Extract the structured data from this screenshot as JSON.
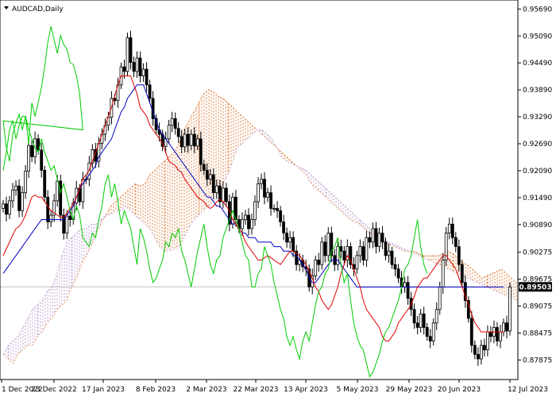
{
  "chart_data": {
    "type": "candlestick",
    "title": "AUDCAD,Daily",
    "timeframe": "Daily",
    "symbol": "AUDCAD",
    "current_price": 0.89503,
    "current_price_label": "0.89503",
    "ylim": [
      0.8744,
      0.9589
    ],
    "y_ticks": [
      "0.95690",
      "0.95090",
      "0.94490",
      "0.93890",
      "0.93290",
      "0.92690",
      "0.92090",
      "0.91490",
      "0.90890",
      "0.90275",
      "0.89675",
      "0.89075",
      "0.88475",
      "0.87875"
    ],
    "x_ticks": [
      "1 Dec 2022",
      "23 Dec 2022",
      "17 Jan 2023",
      "8 Feb 2023",
      "2 Mar 2023",
      "22 Mar 2023",
      "13 Apr 2023",
      "5 May 2023",
      "29 May 2023",
      "20 Jun 2023",
      "12 Jul 2023"
    ],
    "grid": false,
    "colors": {
      "candle": "#000000",
      "tenkan": "#dd0000",
      "kijun": "#0000bb",
      "chikou": "#00cc00",
      "cloud_bullish": "#e08040",
      "cloud_bearish": "#c0a0d0",
      "price_line": "#c0c0c0",
      "price_label_bg": "#000000"
    },
    "series": [
      {
        "name": "close",
        "values": [
          0.9135,
          0.9112,
          0.9142,
          0.9166,
          0.9175,
          0.912,
          0.916,
          0.9208,
          0.9265,
          0.924,
          0.928,
          0.9255,
          0.921,
          0.915,
          0.9095,
          0.911,
          0.9142,
          0.9186,
          0.911,
          0.907,
          0.9108,
          0.91,
          0.9137,
          0.917,
          0.914,
          0.919,
          0.919,
          0.9226,
          0.9256,
          0.923,
          0.927,
          0.929,
          0.931,
          0.9328,
          0.937,
          0.9365,
          0.94,
          0.944,
          0.943,
          0.9505,
          0.945,
          0.943,
          0.946,
          0.942,
          0.9435,
          0.94,
          0.937,
          0.9325,
          0.93,
          0.929,
          0.9263,
          0.928,
          0.931,
          0.9325,
          0.9303,
          0.9285,
          0.9262,
          0.929,
          0.9265,
          0.929,
          0.9264,
          0.928,
          0.9223,
          0.921,
          0.919,
          0.92,
          0.916,
          0.9175,
          0.914,
          0.917,
          0.914,
          0.909,
          0.915,
          0.91,
          0.908,
          0.91,
          0.911,
          0.908,
          0.91,
          0.914,
          0.918,
          0.919,
          0.915,
          0.916,
          0.9125,
          0.9125,
          0.912,
          0.9095,
          0.907,
          0.905,
          0.906,
          0.903,
          0.9,
          0.901,
          0.8995,
          0.899,
          0.895,
          0.8975,
          0.901,
          0.9,
          0.905,
          0.902,
          0.907,
          0.902,
          0.9,
          0.904,
          0.903,
          0.901,
          0.904,
          0.9,
          0.899,
          0.902,
          0.904,
          0.901,
          0.906,
          0.905,
          0.908,
          0.904,
          0.907,
          0.905,
          0.902,
          0.903,
          0.9,
          0.899,
          0.897,
          0.895,
          0.896,
          0.8925,
          0.89,
          0.887,
          0.886,
          0.889,
          0.886,
          0.884,
          0.883,
          0.887,
          0.89,
          0.895,
          0.901,
          0.907,
          0.909,
          0.906,
          0.904,
          0.9,
          0.896,
          0.892,
          0.888,
          0.882,
          0.88,
          0.879,
          0.882,
          0.881,
          0.885,
          0.884,
          0.886,
          0.883,
          0.885,
          0.887,
          0.8852,
          0.895
        ]
      },
      {
        "name": "tenkan",
        "values": [
          0.902,
          0.9035,
          0.905,
          0.9065,
          0.908,
          0.9085,
          0.9095,
          0.911,
          0.913,
          0.915,
          0.9155,
          0.915,
          0.915,
          0.914,
          0.913,
          0.912,
          0.9115,
          0.911,
          0.9105,
          0.9105,
          0.9115,
          0.9125,
          0.9135,
          0.915,
          0.917,
          0.919,
          0.92,
          0.921,
          0.923,
          0.925,
          0.927,
          0.929,
          0.931,
          0.933,
          0.935,
          0.9375,
          0.94,
          0.942,
          0.942,
          0.942,
          0.942,
          0.94,
          0.938,
          0.935,
          0.934,
          0.933,
          0.931,
          0.93,
          0.929,
          0.928,
          0.927,
          0.925,
          0.923,
          0.9225,
          0.922,
          0.921,
          0.9205,
          0.919,
          0.918,
          0.917,
          0.916,
          0.915,
          0.9145,
          0.914,
          0.913,
          0.9125,
          0.913,
          0.914,
          0.9145,
          0.914,
          0.913,
          0.912,
          0.91,
          0.909,
          0.908,
          0.907,
          0.905,
          0.904,
          0.903,
          0.902,
          0.901,
          0.901,
          0.9015,
          0.902,
          0.9015,
          0.901,
          0.9005,
          0.9,
          0.901,
          0.902,
          0.903,
          0.903,
          0.9025,
          0.902,
          0.901,
          0.9,
          0.8985,
          0.897,
          0.895,
          0.894,
          0.892,
          0.891,
          0.89,
          0.891,
          0.893,
          0.895,
          0.898,
          0.9,
          0.902,
          0.901,
          0.899,
          0.897,
          0.895,
          0.892,
          0.89,
          0.889,
          0.888,
          0.887,
          0.886,
          0.884,
          0.883,
          0.883,
          0.884,
          0.885,
          0.887,
          0.888,
          0.889,
          0.89,
          0.891,
          0.893,
          0.895,
          0.896,
          0.897,
          0.897,
          0.898,
          0.899,
          0.9,
          0.901,
          0.902,
          0.902,
          0.901,
          0.9,
          0.899,
          0.897,
          0.895,
          0.893,
          0.891,
          0.889,
          0.887,
          0.886,
          0.885,
          0.885,
          0.885,
          0.885,
          0.885,
          0.885,
          0.885,
          0.885
        ]
      },
      {
        "name": "kijun",
        "values": [
          0.898,
          0.899,
          0.9,
          0.901,
          0.902,
          0.903,
          0.904,
          0.905,
          0.906,
          0.907,
          0.908,
          0.909,
          0.91,
          0.91,
          0.91,
          0.91,
          0.91,
          0.91,
          0.91,
          0.91,
          0.911,
          0.912,
          0.913,
          0.915,
          0.917,
          0.918,
          0.919,
          0.92,
          0.921,
          0.922,
          0.924,
          0.925,
          0.926,
          0.927,
          0.928,
          0.93,
          0.932,
          0.934,
          0.935,
          0.937,
          0.938,
          0.939,
          0.94,
          0.94,
          0.94,
          0.938,
          0.936,
          0.934,
          0.932,
          0.93,
          0.929,
          0.928,
          0.927,
          0.926,
          0.925,
          0.924,
          0.923,
          0.922,
          0.921,
          0.92,
          0.919,
          0.918,
          0.917,
          0.916,
          0.915,
          0.915,
          0.914,
          0.913,
          0.913,
          0.912,
          0.911,
          0.91,
          0.909,
          0.909,
          0.908,
          0.907,
          0.907,
          0.906,
          0.906,
          0.906,
          0.905,
          0.905,
          0.905,
          0.905,
          0.905,
          0.904,
          0.904,
          0.904,
          0.903,
          0.903,
          0.903,
          0.902,
          0.902,
          0.901,
          0.9,
          0.899,
          0.897,
          0.896,
          0.896,
          0.897,
          0.898,
          0.899,
          0.9,
          0.901,
          0.901,
          0.901,
          0.9,
          0.899,
          0.898,
          0.897,
          0.896,
          0.895,
          0.895,
          0.895,
          0.895,
          0.895,
          0.895,
          0.895,
          0.895,
          0.895,
          0.895,
          0.895,
          0.895,
          0.895,
          0.895,
          0.895,
          0.895,
          0.895,
          0.895,
          0.895,
          0.895,
          0.895,
          0.895,
          0.895,
          0.895,
          0.895,
          0.895,
          0.895,
          0.895,
          0.895,
          0.895,
          0.895,
          0.895,
          0.895,
          0.895,
          0.895,
          0.895,
          0.895,
          0.895,
          0.895,
          0.895,
          0.895,
          0.895,
          0.895,
          0.895,
          0.895,
          0.895,
          0.895
        ]
      },
      {
        "name": "chikou",
        "values": [
          0.921,
          0.925,
          0.93,
          0.932,
          0.928,
          0.931,
          0.933,
          0.933,
          0.927,
          0.936,
          0.933,
          0.936,
          0.9395,
          0.944,
          0.9495,
          0.953,
          0.95,
          0.947,
          0.951,
          0.949,
          0.948,
          0.945,
          0.9445,
          0.942,
          0.938,
          0.93,
          0.932,
          0.926,
          0.923,
          0.929,
          0.9315,
          0.9335,
          0.93,
          0.933,
          0.93,
          0.928,
          0.926,
          0.925,
          0.928,
          0.925,
          0.923,
          0.921,
          0.922,
          0.919,
          0.916,
          0.918,
          0.915,
          0.912,
          0.91,
          0.913,
          0.911,
          0.906,
          0.905,
          0.904,
          0.907,
          0.906,
          0.91,
          0.913,
          0.918,
          0.92,
          0.915,
          0.918,
          0.914,
          0.909,
          0.912,
          0.91,
          0.908,
          0.904,
          0.9,
          0.908,
          0.906,
          0.903,
          0.899,
          0.896,
          0.897,
          0.899,
          0.901,
          0.905,
          0.904,
          0.907,
          0.906,
          0.908,
          0.903,
          0.901,
          0.898,
          0.895,
          0.899,
          0.903,
          0.906,
          0.909,
          0.904,
          0.9,
          0.898,
          0.901,
          0.902,
          0.906,
          0.908,
          0.91,
          0.912,
          0.91,
          0.908,
          0.905,
          0.902,
          0.901,
          0.895,
          0.895,
          0.898,
          0.899,
          0.904,
          0.902,
          0.9,
          0.896,
          0.893,
          0.89,
          0.888,
          0.884,
          0.882,
          0.884,
          0.881,
          0.879,
          0.883,
          0.885,
          0.883,
          0.887,
          0.891,
          0.894,
          0.895,
          0.898,
          0.899,
          0.903,
          0.904,
          0.906,
          0.9,
          0.896,
          0.898,
          0.892,
          0.887,
          0.884,
          0.882,
          0.881,
          0.878,
          0.875,
          0.876,
          0.878,
          0.88,
          0.883,
          0.885,
          0.886,
          0.888,
          0.89,
          0.892,
          0.895,
          0.899,
          0.9,
          0.902,
          0.906,
          0.91,
          0.904,
          0.9,
          0.898
        ]
      },
      {
        "name": "senkou_a",
        "values": [
          0.88,
          0.879,
          0.878,
          0.88,
          0.881,
          0.882,
          0.882,
          0.884,
          0.885,
          0.887,
          0.888,
          0.89,
          0.891,
          0.892,
          0.895,
          0.897,
          0.9,
          0.902,
          0.904,
          0.907,
          0.909,
          0.911,
          0.913,
          0.914,
          0.915,
          0.916,
          0.917,
          0.918,
          0.9175,
          0.918,
          0.92,
          0.921,
          0.922,
          0.923,
          0.924,
          0.925,
          0.927,
          0.93,
          0.932,
          0.934,
          0.936,
          0.938,
          0.939,
          0.9385,
          0.9375,
          0.937,
          0.936,
          0.935,
          0.934,
          0.933,
          0.932,
          0.931,
          0.93,
          0.929,
          0.928,
          0.927,
          0.926,
          0.925,
          0.924,
          0.923,
          0.922,
          0.921,
          0.92,
          0.918,
          0.917,
          0.916,
          0.915,
          0.914,
          0.913,
          0.912,
          0.911,
          0.91,
          0.9095,
          0.909,
          0.908,
          0.907,
          0.9065,
          0.906,
          0.905,
          0.9045,
          0.904,
          0.9035,
          0.903,
          0.903,
          0.903,
          0.9025,
          0.902,
          0.902,
          0.902,
          0.902,
          0.9025,
          0.903,
          0.9025,
          0.9015,
          0.9005,
          0.9,
          0.899,
          0.898,
          0.897,
          0.8975,
          0.898,
          0.8985,
          0.899,
          0.898,
          0.897,
          0.896
        ]
      },
      {
        "name": "senkou_b",
        "values": [
          0.88,
          0.882,
          0.883,
          0.884,
          0.886,
          0.888,
          0.89,
          0.891,
          0.892,
          0.894,
          0.895,
          0.898,
          0.902,
          0.905,
          0.906,
          0.907,
          0.908,
          0.908,
          0.909,
          0.909,
          0.91,
          0.911,
          0.911,
          0.912,
          0.912,
          0.913,
          0.912,
          0.911,
          0.91,
          0.909,
          0.908,
          0.906,
          0.904,
          0.903,
          0.903,
          0.9035,
          0.904,
          0.906,
          0.908,
          0.91,
          0.911,
          0.912,
          0.913,
          0.914,
          0.916,
          0.918,
          0.92,
          0.923,
          0.926,
          0.927,
          0.928,
          0.929,
          0.93,
          0.93,
          0.929,
          0.928,
          0.926,
          0.924,
          0.923,
          0.9225,
          0.922,
          0.9215,
          0.921,
          0.92,
          0.919,
          0.918,
          0.917,
          0.916,
          0.915,
          0.914,
          0.913,
          0.912,
          0.911,
          0.91,
          0.909,
          0.908,
          0.907,
          0.906,
          0.9055,
          0.905,
          0.9045,
          0.904,
          0.9035,
          0.903,
          0.9025,
          0.902,
          0.9015,
          0.901,
          0.9005,
          0.9,
          0.8995,
          0.899,
          0.8985,
          0.898,
          0.8975,
          0.897,
          0.8965,
          0.896,
          0.8955,
          0.895,
          0.8945,
          0.894,
          0.8935,
          0.893,
          0.8925,
          0.892
        ]
      }
    ]
  }
}
